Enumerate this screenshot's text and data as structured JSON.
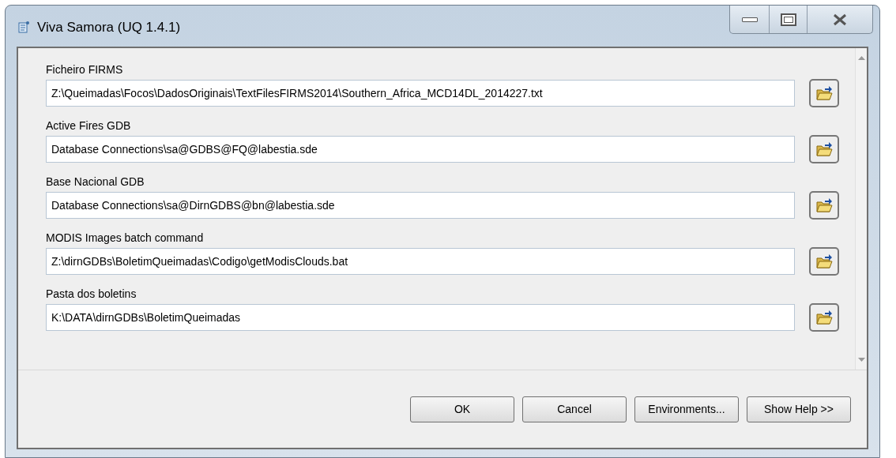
{
  "window": {
    "title": "Viva Samora (UQ 1.4.1)"
  },
  "fields": [
    {
      "label": "Ficheiro FIRMS",
      "value": "Z:\\Queimadas\\Focos\\DadosOriginais\\TextFilesFIRMS2014\\Southern_Africa_MCD14DL_2014227.txt"
    },
    {
      "label": "Active Fires GDB",
      "value": "Database Connections\\sa@GDBS@FQ@labestia.sde"
    },
    {
      "label": "Base Nacional GDB",
      "value": "Database Connections\\sa@DirnGDBS@bn@labestia.sde"
    },
    {
      "label": "MODIS Images batch command",
      "value": "Z:\\dirnGDBs\\BoletimQueimadas\\Codigo\\getModisClouds.bat"
    },
    {
      "label": "Pasta dos boletins",
      "value": "K:\\DATA\\dirnGDBs\\BoletimQueimadas"
    }
  ],
  "buttons": [
    "OK",
    "Cancel",
    "Environments...",
    "Show Help >>"
  ]
}
